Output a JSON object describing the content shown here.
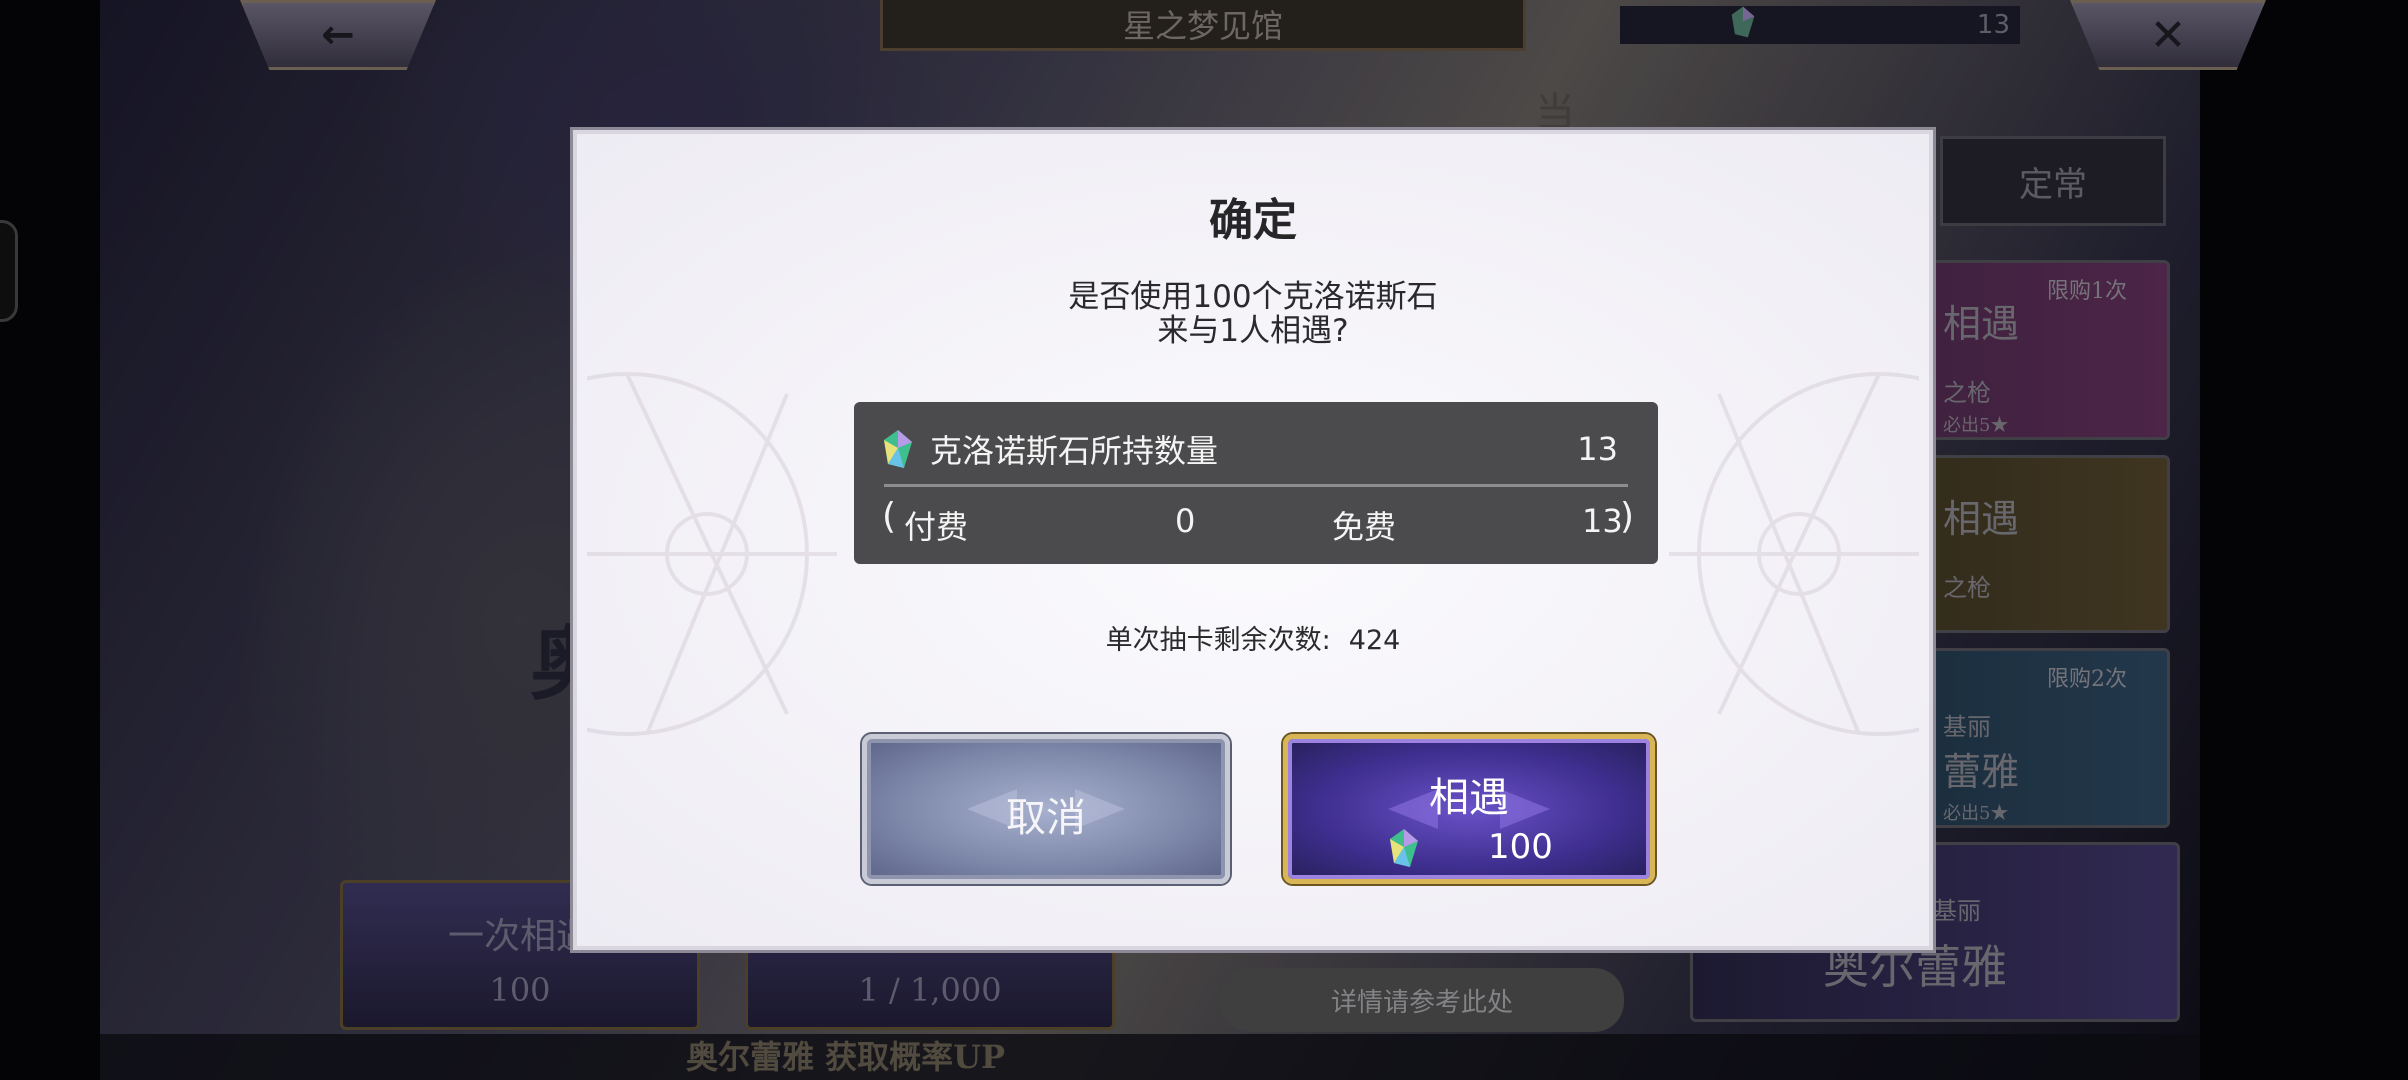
{
  "header": {
    "back_icon": "←",
    "title": "星之梦见馆",
    "stone_count": "13",
    "close_icon": "✕"
  },
  "background": {
    "side_char": "当",
    "big_char": "奥",
    "tab_label": "定常",
    "banners": [
      {
        "main": "相遇",
        "sub": "之枪",
        "tag": "限购1次",
        "note": "必出5★"
      },
      {
        "main": "相遇",
        "sub": "之枪",
        "tag": "",
        "note": ""
      },
      {
        "main": "蕾雅",
        "sub": "基丽",
        "tag": "限购2次",
        "note": "必出5★"
      },
      {
        "main": "奥尔蕾雅",
        "sub": "基丽",
        "tag": "",
        "note": ""
      }
    ],
    "single_pull": {
      "label": "一次相遇",
      "cost": "100"
    },
    "multi_pull": {
      "cost": "1 / 1,000"
    },
    "details": "详情请参考此处",
    "rate_up": "奥尔蕾雅 获取概率UP"
  },
  "dialog": {
    "title": "确定",
    "message_line1": "是否使用100个克洛诺斯石",
    "message_line2": "来与1人相遇?",
    "stone_label": "克洛诺斯石所持数量",
    "stone_total": "13",
    "paid_label": "付费",
    "paid_value": "0",
    "free_label": "免费",
    "free_value": "13",
    "open_paren": "(",
    "close_paren": ")",
    "remaining_label": "单次抽卡剩余次数:",
    "remaining_value": "424",
    "cancel_label": "取消",
    "confirm_label": "相遇",
    "confirm_cost": "100"
  },
  "colors": {
    "dialog_bg": "#f4f3f7",
    "panel_bg": "#4b4b4d",
    "confirm_gold": "#d8b656",
    "confirm_purple": "#4a38a8",
    "cancel_blue": "#8a93b5"
  },
  "icons": {
    "crystal": "chronos-stone-icon"
  }
}
